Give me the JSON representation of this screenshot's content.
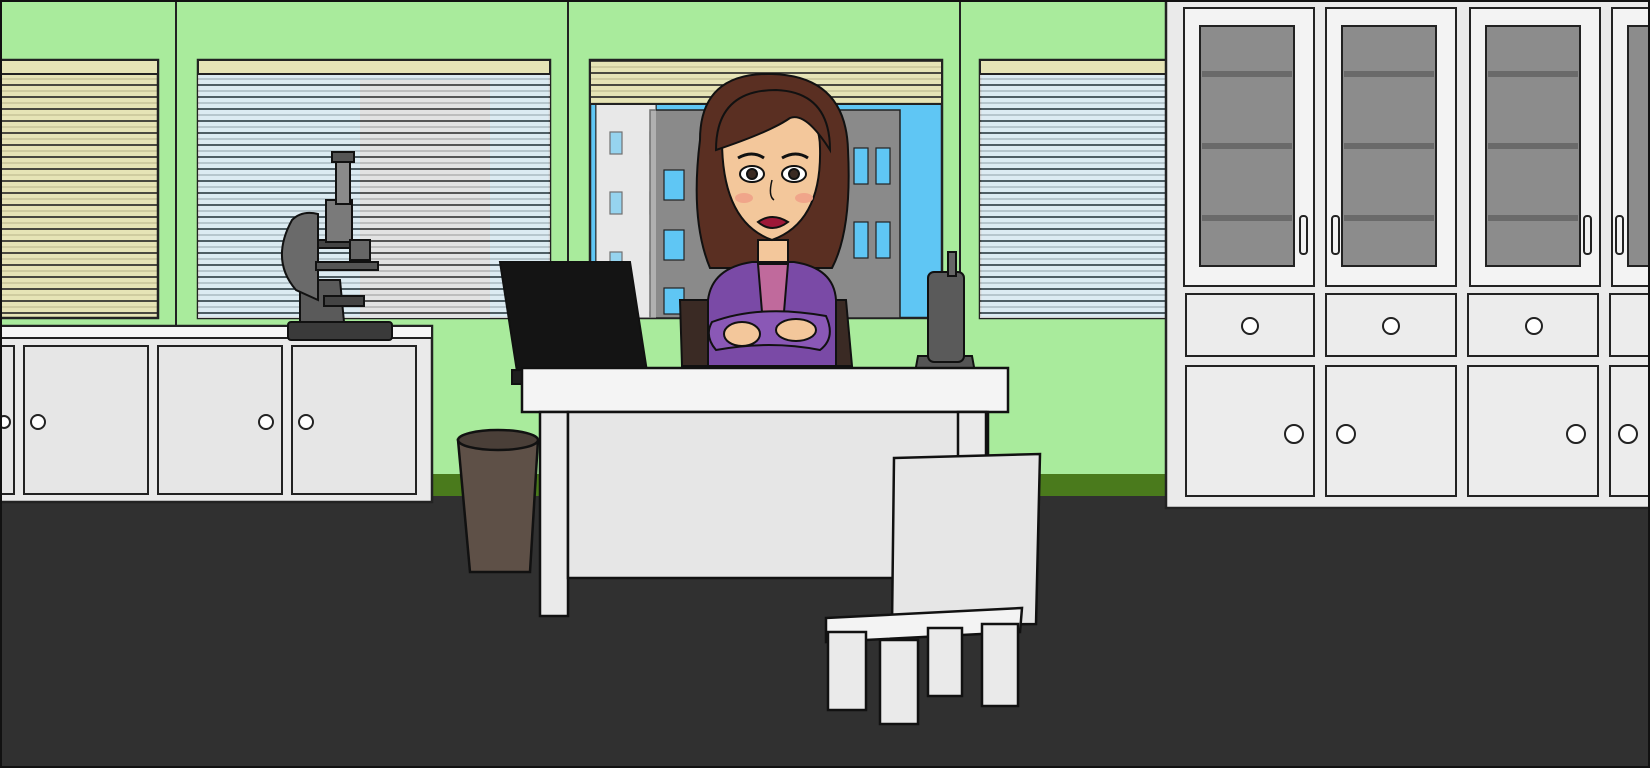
{
  "scene": {
    "kind": "cartoon-office-illustration",
    "colors": {
      "wall": "#a9eb9c",
      "wall_trim": "#4a7a1c",
      "floor": "#303030",
      "furniture": "#eaeaea",
      "outline": "#111111",
      "blind": "#f2f2f2",
      "blind_cream": "#e6e4b6",
      "sky": "#5fc6f4",
      "building": "#8a8a8a",
      "laptop": "#141414",
      "trash_bin": "#5e5047",
      "glass": "#8c8c8c",
      "suit": "#7a4aa6",
      "shirt": "#c06a9c",
      "hair": "#5a2f22",
      "skin": "#f3c79b",
      "lips": "#9e1838"
    },
    "objects": [
      "window-blinds",
      "microscope",
      "laptop",
      "desk",
      "desk-phone",
      "trash-bin",
      "office-chair",
      "glass-cabinet",
      "lower-cabinet",
      "scientist-character"
    ]
  }
}
